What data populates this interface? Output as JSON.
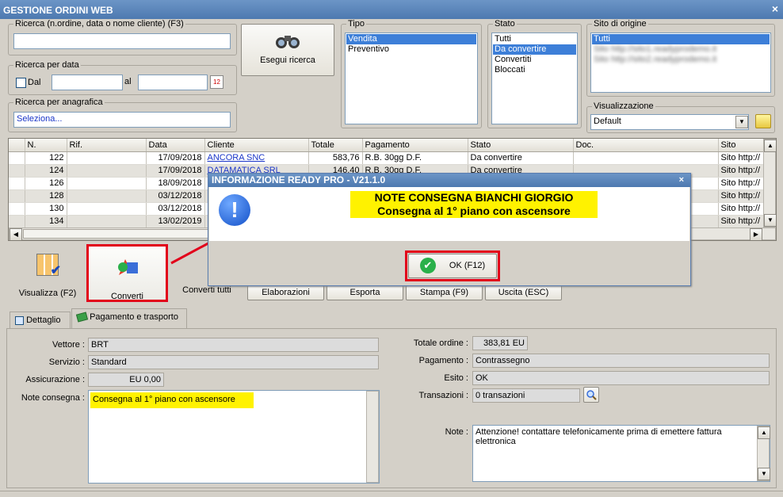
{
  "window": {
    "title": "GESTIONE ORDINI WEB",
    "close": "×"
  },
  "search": {
    "label": "Ricerca (n.ordine, data o nome cliente) (F3)",
    "value": ""
  },
  "date_search": {
    "label": "Ricerca per data",
    "dal_label": "Dal",
    "al_label": "al",
    "from": "",
    "to": ""
  },
  "anag_search": {
    "label": "Ricerca per anagrafica",
    "value": "Seleziona..."
  },
  "search_button": {
    "label": "Esegui ricerca"
  },
  "tipo": {
    "label": "Tipo",
    "items": [
      "Vendita",
      "Preventivo"
    ],
    "selected": "Vendita"
  },
  "stato": {
    "label": "Stato",
    "items": [
      "Tutti",
      "Da convertire",
      "Convertiti",
      "Bloccati"
    ],
    "selected": "Da convertire"
  },
  "sito": {
    "label": "Sito di origine",
    "items": [
      "Tutti",
      "Sito http://sito1.readyprodemo.it",
      "Sito http://sito2.readyprodemo.it"
    ],
    "selected": "Tutti"
  },
  "visualizzazione": {
    "label": "Visualizzazione",
    "value": "Default"
  },
  "table": {
    "columns": [
      "N.",
      "Rif.",
      "Data",
      "Cliente",
      "Totale",
      "Pagamento",
      "Stato",
      "Doc.",
      "Sito"
    ],
    "rows": [
      [
        "122",
        "",
        "17/09/2018",
        "ANCORA SNC",
        "583,76",
        "R.B. 30gg D.F.",
        "Da convertire",
        "",
        "Sito http://"
      ],
      [
        "124",
        "",
        "17/09/2018",
        "DATAMATICA SRL",
        "146,40",
        "R.B. 30gg D.F.",
        "Da convertire",
        "",
        "Sito http://"
      ],
      [
        "126",
        "",
        "18/09/2018",
        "",
        "",
        "",
        "",
        "",
        "Sito http://"
      ],
      [
        "128",
        "",
        "03/12/2018",
        "",
        "",
        "",
        "",
        "",
        "Sito http://"
      ],
      [
        "130",
        "",
        "03/12/2018",
        "",
        "",
        "",
        "",
        "",
        "Sito http://"
      ],
      [
        "134",
        "",
        "13/02/2019",
        "",
        "",
        "",
        "",
        "",
        "Sito http://"
      ]
    ]
  },
  "toolbar": {
    "visualizza": "Visualizza (F2)",
    "converti": "Converti",
    "converti_tutti": "Converti tutti",
    "elaborazioni": "Elaborazioni",
    "esporta": "Esporta",
    "stampa": "Stampa (F9)",
    "uscita": "Uscita (ESC)"
  },
  "tabs": {
    "dettaglio": "Dettaglio",
    "pagamento": "Pagamento e trasporto"
  },
  "detail": {
    "vettore_label": "Vettore :",
    "vettore": "BRT",
    "servizio_label": "Servizio :",
    "servizio": "Standard",
    "assicurazione_label": "Assicurazione :",
    "assicurazione": "EU 0,00",
    "note_consegna_label": "Note consegna :",
    "note_consegna": "Consegna al 1° piano con ascensore",
    "totale_label": "Totale ordine :",
    "totale": "383,81 EU",
    "pagamento_label": "Pagamento :",
    "pagamento": "Contrassegno",
    "esito_label": "Esito :",
    "esito": "OK",
    "transazioni_label": "Transazioni :",
    "transazioni": "0 transazioni",
    "note_label": "Note :",
    "note": "Attenzione! contattare telefonicamente prima di emettere fattura elettronica"
  },
  "dialog": {
    "title": "INFORMAZIONE READY PRO - V21.1.0",
    "close": "×",
    "line1": "NOTE CONSEGNA BIANCHI GIORGIO",
    "line2": "Consegna al 1° piano con ascensore",
    "ok": "OK (F12)"
  },
  "colors": {
    "highlight": "#fff200",
    "annotation": "#e2001a",
    "selection": "#3d7fd8",
    "link": "#1a35c8"
  }
}
